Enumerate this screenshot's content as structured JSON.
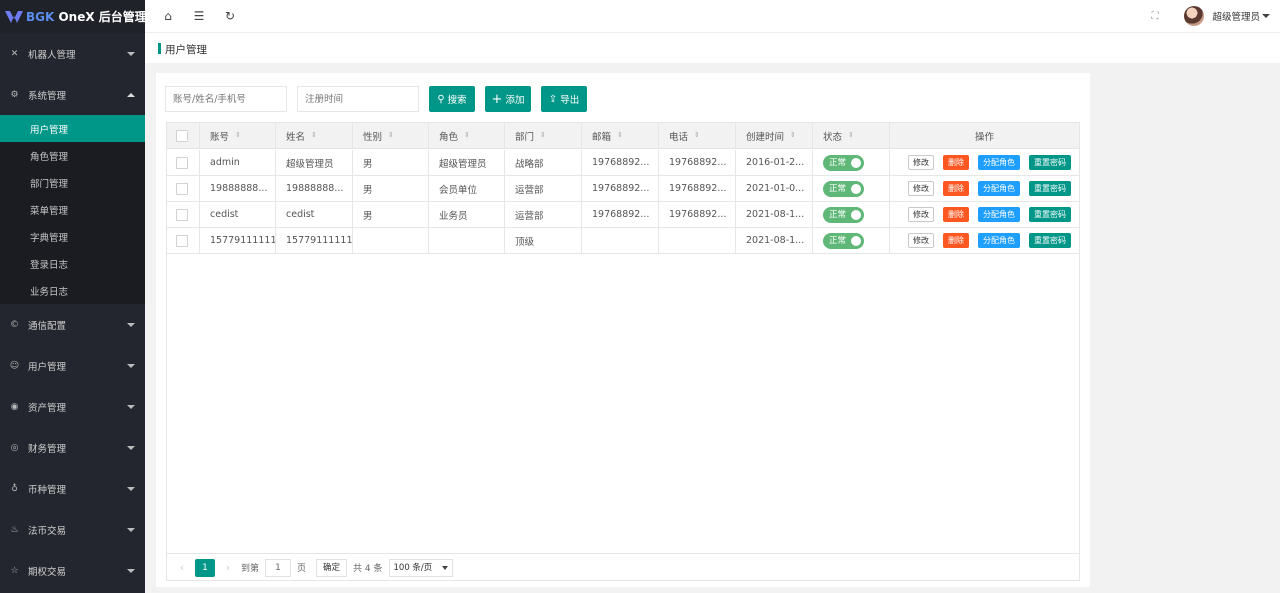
{
  "app": {
    "logo_prefix": "BGK",
    "logo_suffix": " OneX 后台管理"
  },
  "sidebar": {
    "groups": [
      {
        "label": "机器人管理",
        "icon": "robot-icon",
        "glyph": "✕"
      },
      {
        "label": "系统管理",
        "icon": "gear-icon",
        "glyph": "⚙",
        "expanded": true
      },
      {
        "label": "通信配置",
        "icon": "chat-icon",
        "glyph": "©"
      },
      {
        "label": "用户管理",
        "icon": "user-icon",
        "glyph": "☺"
      },
      {
        "label": "资产管理",
        "icon": "asset-icon",
        "glyph": "◉"
      },
      {
        "label": "财务管理",
        "icon": "finance-icon",
        "glyph": "◎"
      },
      {
        "label": "币种管理",
        "icon": "coin-icon",
        "glyph": "♁"
      },
      {
        "label": "法币交易",
        "icon": "fire-icon",
        "glyph": "♨"
      },
      {
        "label": "期权交易",
        "icon": "star-icon",
        "glyph": "☆"
      }
    ],
    "sub_items": [
      "用户管理",
      "角色管理",
      "部门管理",
      "菜单管理",
      "字典管理",
      "登录日志",
      "业务日志"
    ],
    "active_sub": 0
  },
  "topbar": {
    "user_name": "超级管理员"
  },
  "breadcrumb": {
    "title": "用户管理"
  },
  "search": {
    "account_placeholder": "账号/姓名/手机号",
    "date_placeholder": "注册时间",
    "search_label": "搜索",
    "add_label": "添加",
    "export_label": "导出"
  },
  "table": {
    "headers": [
      "账号",
      "姓名",
      "性别",
      "角色",
      "部门",
      "邮箱",
      "电话",
      "创建时间",
      "状态",
      "操作"
    ],
    "rows": [
      {
        "account": "admin",
        "name": "超级管理员",
        "gender": "男",
        "role": "超级管理员",
        "dept": "战略部",
        "email": "19768892...",
        "phone": "19768892...",
        "created": "2016-01-2...",
        "status": "正常"
      },
      {
        "account": "19888888...",
        "name": "19888888...",
        "gender": "男",
        "role": "会员单位",
        "dept": "运营部",
        "email": "19768892...",
        "phone": "19768892...",
        "created": "2021-01-0...",
        "status": "正常"
      },
      {
        "account": "cedist",
        "name": "cedist",
        "gender": "男",
        "role": "业务员",
        "dept": "运营部",
        "email": "19768892...",
        "phone": "19768892...",
        "created": "2021-08-1...",
        "status": "正常"
      },
      {
        "account": "15779111111",
        "name": "15779111111",
        "gender": "",
        "role": "",
        "dept": "顶级",
        "email": "",
        "phone": "",
        "created": "2021-08-1...",
        "status": "正常"
      }
    ],
    "op_labels": {
      "edit": "修改",
      "delete": "删除",
      "assign_role": "分配角色",
      "reset_pwd": "重置密码"
    }
  },
  "pager": {
    "current_page": "1",
    "goto_label": "到第",
    "page_input": "1",
    "page_unit": "页",
    "confirm_label": "确定",
    "total_label": "共 4 条",
    "page_size": "100 条/页"
  },
  "colors": {
    "primary": "#009688",
    "sidebar_bg": "#23262e",
    "danger": "#ff5722",
    "info": "#1e9fff",
    "switch_on": "#5fb878"
  }
}
